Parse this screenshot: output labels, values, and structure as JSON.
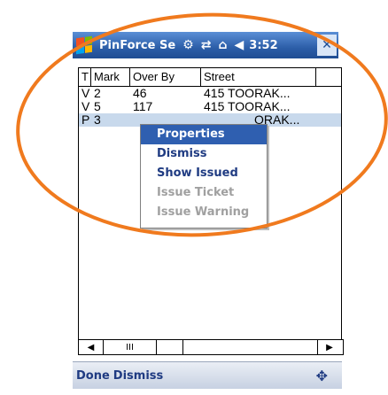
{
  "window": {
    "title": "PinForce Se",
    "status_icons": [
      "settings-icon",
      "sync-icon",
      "signal-icon",
      "volume-icon"
    ],
    "clock": "3:52",
    "close_label": "✕"
  },
  "table": {
    "columns": [
      "T",
      "Mark",
      "Over By",
      "Street",
      ""
    ],
    "rows": [
      {
        "t": "V",
        "mark": "2",
        "over_by": "46",
        "street": "415 TOORAK..."
      },
      {
        "t": "V",
        "mark": "5",
        "over_by": "117",
        "street": "415 TOORAK..."
      },
      {
        "t": "P",
        "mark": "3",
        "over_by": "",
        "street": "ORAK..."
      }
    ]
  },
  "scrollbar": {
    "left_arrow": "◀",
    "thumb": "III",
    "right_arrow": "▶"
  },
  "context_menu": {
    "items": [
      {
        "label": "Properties",
        "highlighted": true,
        "disabled": false
      },
      {
        "label": "Dismiss",
        "highlighted": false,
        "disabled": false
      },
      {
        "label": "Show Issued",
        "highlighted": false,
        "disabled": false
      },
      {
        "label": "Issue Ticket",
        "highlighted": false,
        "disabled": true
      },
      {
        "label": "Issue Warning",
        "highlighted": false,
        "disabled": true
      }
    ]
  },
  "softkeys": {
    "left": "Done",
    "right": "Dismiss",
    "keyboard_icon": "keyboard-icon"
  },
  "colors": {
    "titlebar": "#2c5ea8",
    "menu_highlight": "#2f5fb0",
    "annotation": "#f07a1e"
  }
}
